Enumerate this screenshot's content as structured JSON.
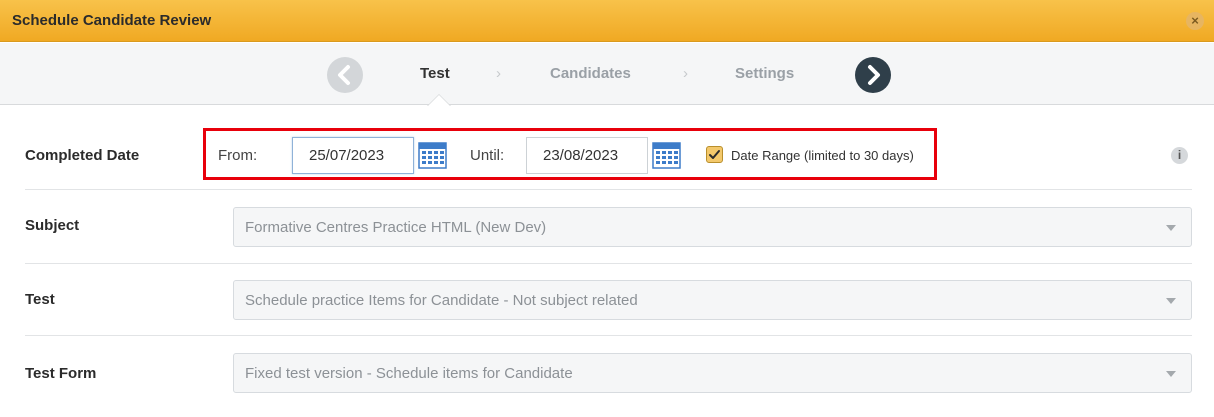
{
  "window": {
    "title": "Schedule Candidate Review",
    "close_icon": "×"
  },
  "wizard": {
    "steps": [
      {
        "label": "Test",
        "active": true
      },
      {
        "label": "Candidates",
        "active": false
      },
      {
        "label": "Settings",
        "active": false
      }
    ],
    "separator": "›"
  },
  "completed_date": {
    "label": "Completed Date",
    "from_label": "From:",
    "from_value": "25/07/2023",
    "until_label": "Until:",
    "until_value": "23/08/2023",
    "date_range_checked": true,
    "date_range_label": "Date Range (limited to 30 days)",
    "info_glyph": "i"
  },
  "subject": {
    "label": "Subject",
    "value": "Formative Centres Practice HTML (New Dev)"
  },
  "test": {
    "label": "Test",
    "value": "Schedule practice Items for Candidate - Not subject related"
  },
  "test_form": {
    "label": "Test Form",
    "value": "Fixed test version - Schedule items for Candidate"
  },
  "colors": {
    "titlebar": "#f0a923",
    "highlight": "#e8000b",
    "nav_next": "#2f3f4a"
  }
}
